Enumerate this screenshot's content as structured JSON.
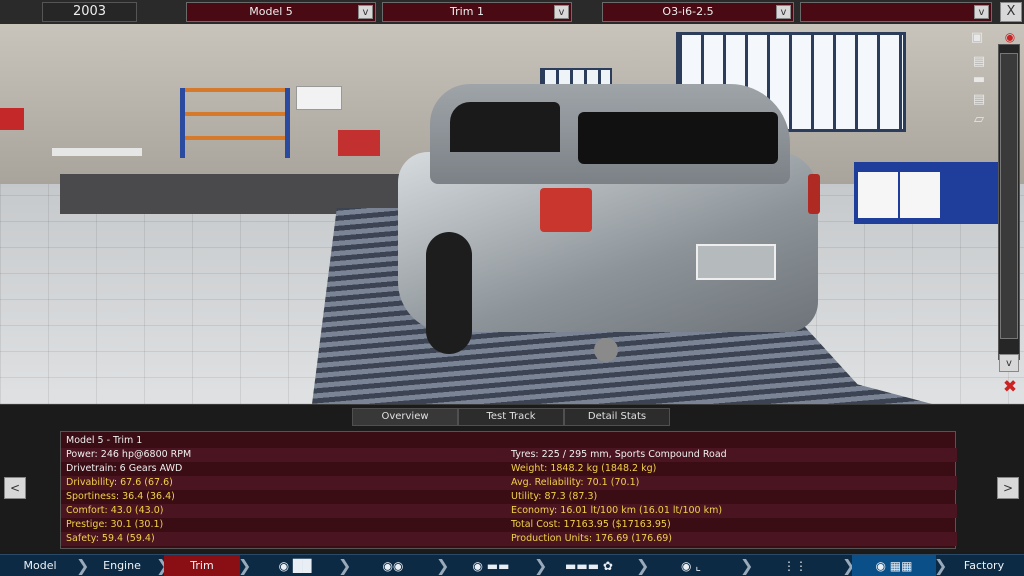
{
  "topbar": {
    "year": "2003",
    "model_select": "Model 5",
    "trim_select": "Trim 1",
    "engine_select": "O3-i6-2.5",
    "extra_select": "",
    "dropdown_glyph": "v",
    "close_glyph": "X"
  },
  "viewport": {
    "scroll_down_glyph": "v"
  },
  "panel": {
    "tabs": [
      "Overview",
      "Test Track",
      "Detail Stats"
    ],
    "active_tab": "Overview",
    "nav_left": "<",
    "nav_right": ">",
    "left_col": [
      {
        "text": "Model 5 - Trim 1",
        "highlight": false
      },
      {
        "text": "Power: 246 hp@6800 RPM",
        "highlight": false
      },
      {
        "text": "Drivetrain: 6 Gears AWD",
        "highlight": false
      },
      {
        "text": "Drivability: 67.6 (67.6)",
        "highlight": true
      },
      {
        "text": "Sportiness: 36.4 (36.4)",
        "highlight": true
      },
      {
        "text": "Comfort: 43.0 (43.0)",
        "highlight": true
      },
      {
        "text": "Prestige: 30.1 (30.1)",
        "highlight": true
      },
      {
        "text": "Safety: 59.4 (59.4)",
        "highlight": true
      }
    ],
    "right_col": [
      {
        "text": "",
        "highlight": false
      },
      {
        "text": "Tyres: 225 / 295 mm, Sports Compound Road",
        "highlight": false
      },
      {
        "text": "Weight: 1848.2 kg (1848.2 kg)",
        "highlight": true
      },
      {
        "text": "Avg. Reliability: 70.1 (70.1)",
        "highlight": true
      },
      {
        "text": "Utility: 87.3 (87.3)",
        "highlight": true
      },
      {
        "text": "Economy: 16.01 lt/100 km (16.01 lt/100 km)",
        "highlight": true
      },
      {
        "text": "Total Cost: 17163.95 ($17163.95)",
        "highlight": true
      },
      {
        "text": "Production Units: 176.69 (176.69)",
        "highlight": true
      }
    ],
    "highlight_color": "#f2d24a"
  },
  "bottomnav": {
    "model": "Model",
    "engine": "Engine",
    "trim": "Trim",
    "factory": "Factory",
    "active": "Trim",
    "icons": [
      "steering-gears-icon",
      "brakes-icon",
      "body-icon",
      "car-exterior-icon",
      "fan-icon",
      "interior-icon",
      "suspension-icon",
      "test-flag-icon"
    ]
  }
}
